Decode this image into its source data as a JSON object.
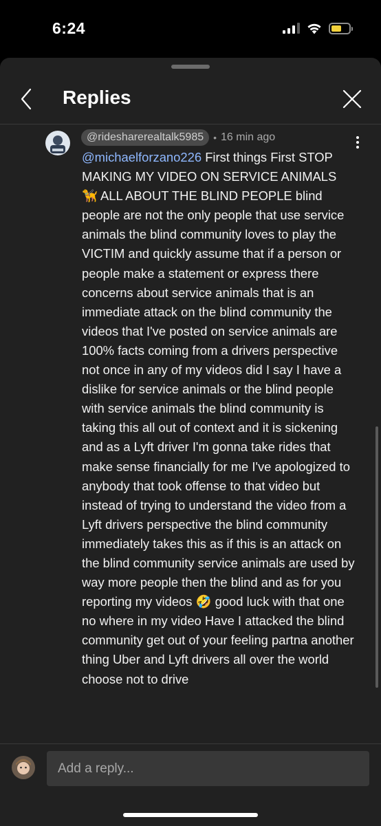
{
  "status_bar": {
    "time": "6:24",
    "signal_icon": "cellular-signal-icon",
    "wifi_icon": "wifi-icon",
    "battery_icon": "battery-icon",
    "battery_level": 0.6,
    "battery_color": "#f4d23c"
  },
  "header": {
    "title": "Replies",
    "back_icon": "chevron-left-icon",
    "close_icon": "close-icon"
  },
  "comment": {
    "author": "@ridesharerealtalk5985",
    "separator": "•",
    "timestamp": "16 min ago",
    "more_icon": "more-vertical-icon",
    "mention": "@michaelforzano226",
    "body": "  First things First STOP MAKING MY VIDEO ON SERVICE ANIMALS 🦮 ALL ABOUT THE BLIND PEOPLE blind people are not the only people that use service animals the blind community loves to play the VICTIM and quickly assume that if a person or people make a statement or express there concerns about service animals that is an immediate attack on the blind community the videos that I've posted on service animals are 100% facts coming from a drivers perspective not once in any of my videos did I say I have a dislike for service animals or the blind people with service animals the blind community is taking this all out of context and it is sickening and as a Lyft driver I'm gonna take rides that make sense financially for me I've apologized to anybody that took offense to that video but instead of trying to understand the video from a Lyft drivers perspective the blind community immediately takes this as if this is an attack on the blind community service animals are used by way more people then the blind and as for you reporting my videos 🤣 good luck with that one no where in my video    Have I attacked the blind community get out of your feeling partna another thing Uber and Lyft drivers all over the world choose not to drive"
  },
  "reply_bar": {
    "placeholder": "Add a reply..."
  },
  "colors": {
    "sheet_background": "#212121",
    "mention": "#8fb8ff",
    "author_chip": "#4a4a4a"
  }
}
